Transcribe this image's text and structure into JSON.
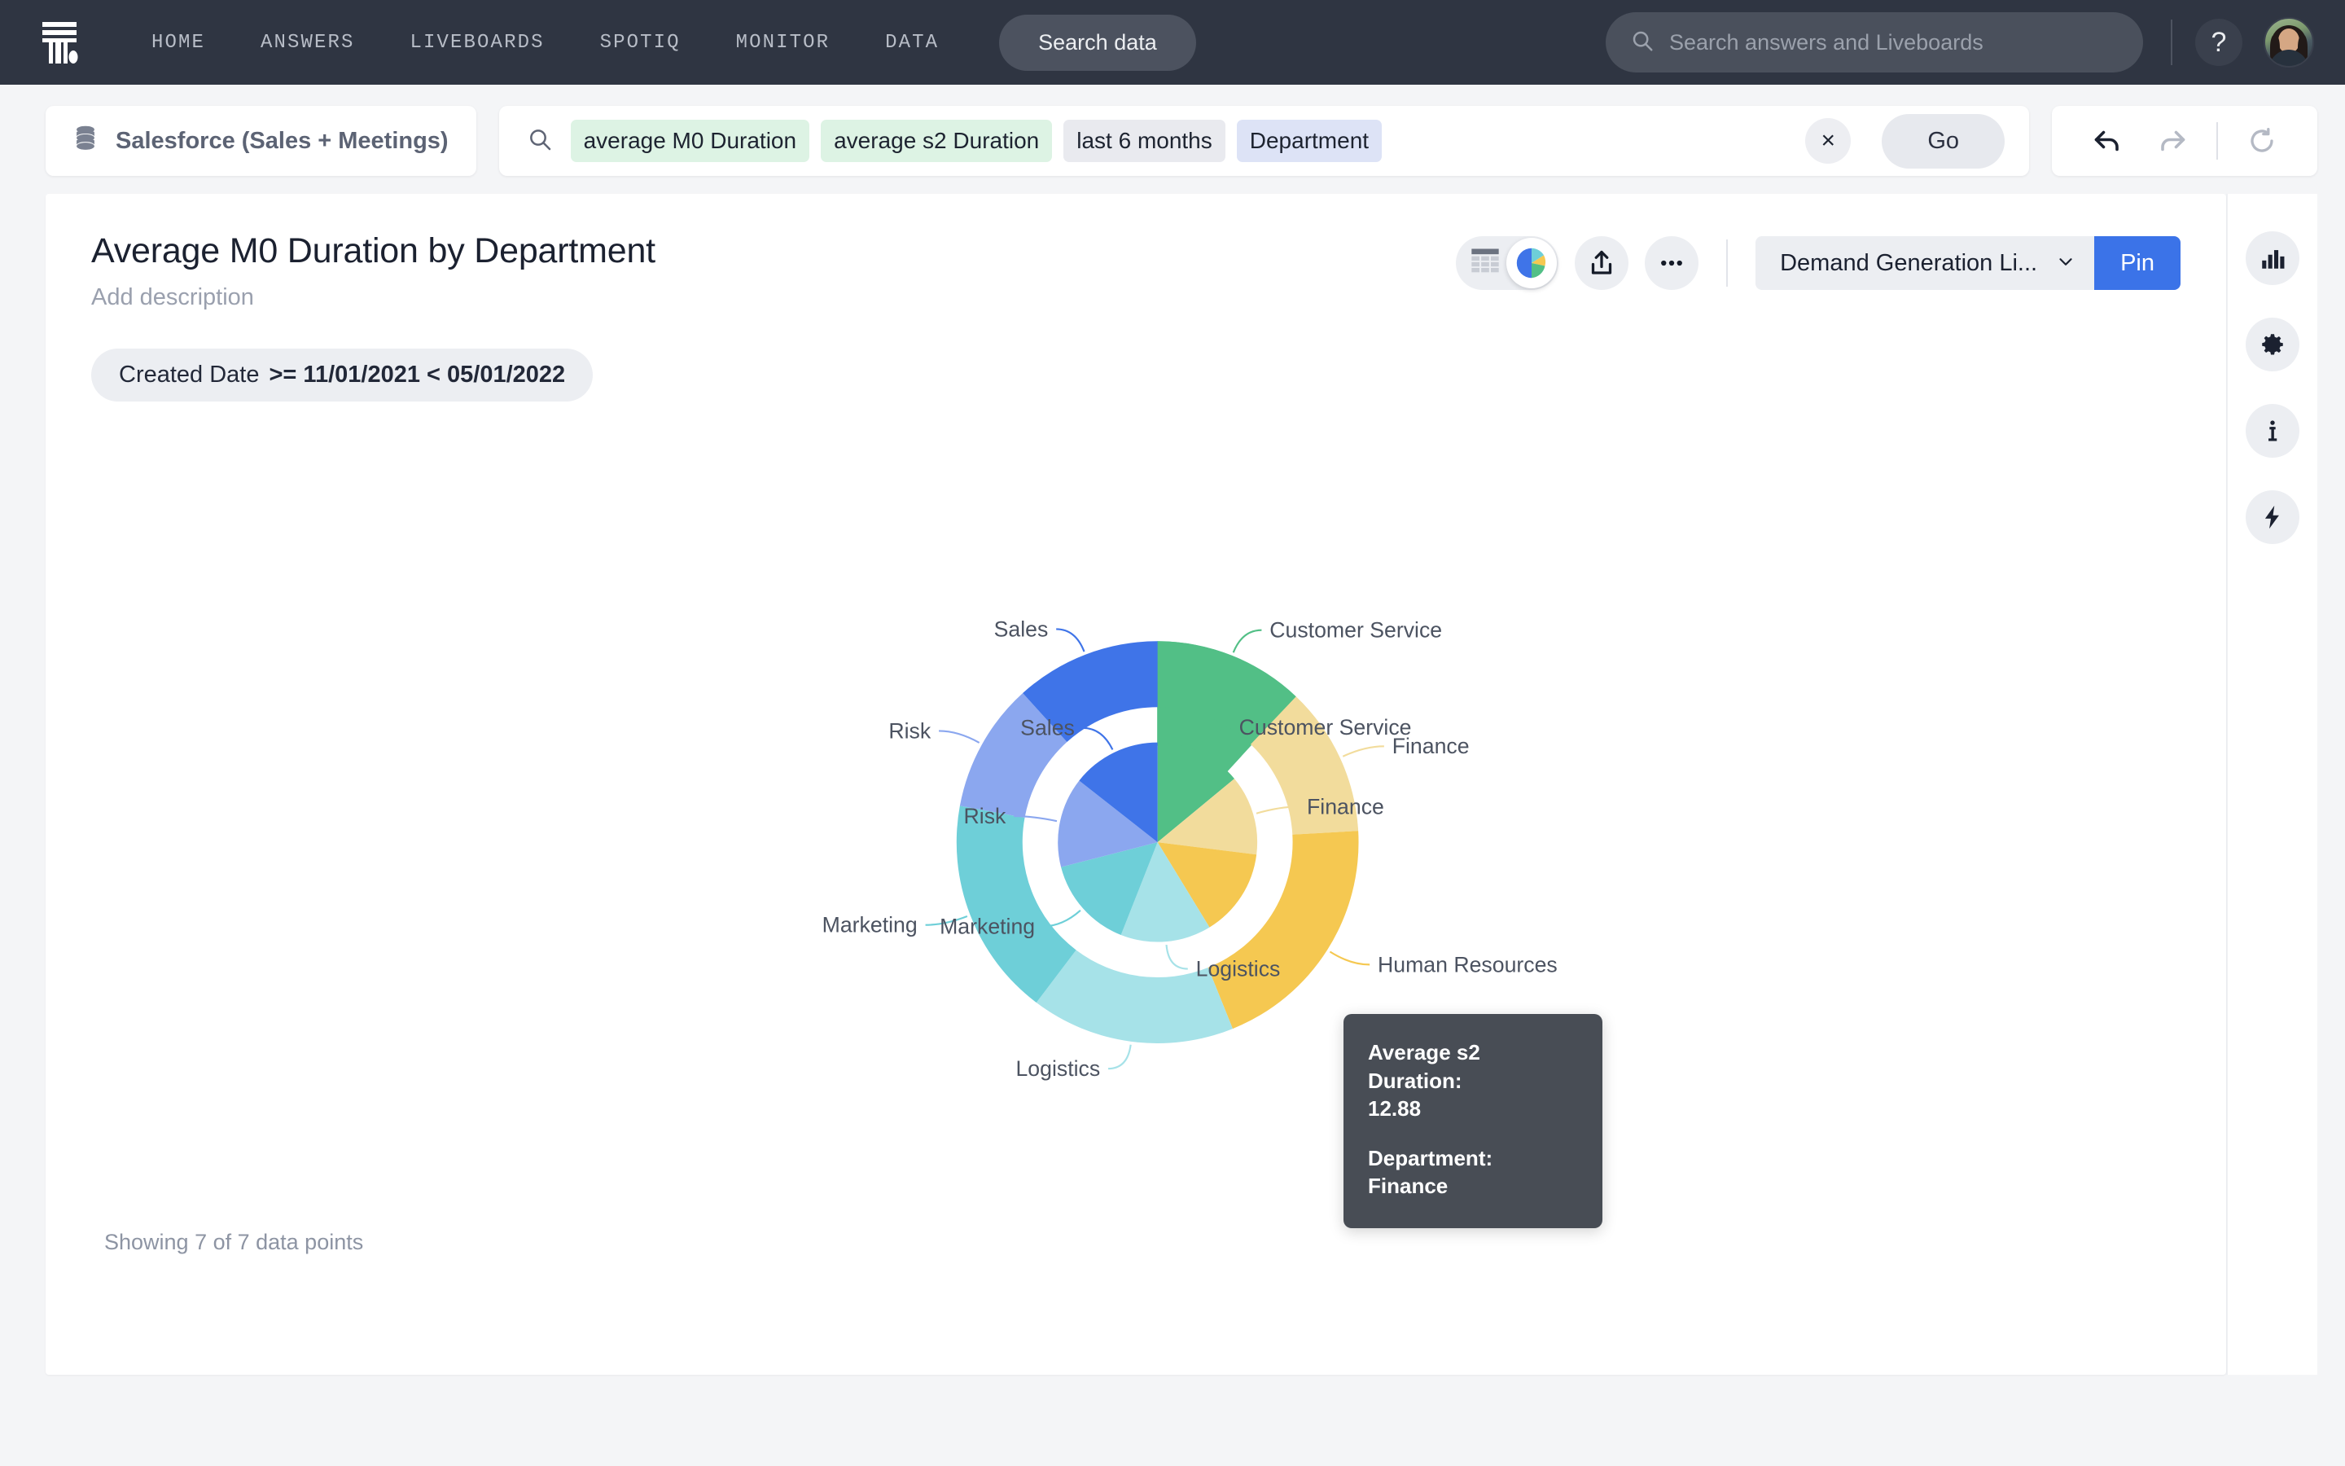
{
  "topnav": {
    "logo_name": "thoughtspot-logo",
    "links": [
      "HOME",
      "ANSWERS",
      "LIVEBOARDS",
      "SPOTIQ",
      "MONITOR",
      "DATA"
    ],
    "search_data_label": "Search data",
    "global_search_placeholder": "Search answers and Liveboards",
    "global_search_value": "",
    "help_label": "?",
    "brand_bg": "#2f3542"
  },
  "querybar": {
    "source_label": "Salesforce (Sales + Meetings)",
    "tokens": [
      {
        "text": "average M0 Duration",
        "kind": "measure"
      },
      {
        "text": "average s2 Duration",
        "kind": "measure"
      },
      {
        "text": "last 6 months",
        "kind": "time"
      },
      {
        "text": "Department",
        "kind": "attr"
      }
    ],
    "clear_label": "×",
    "go_label": "Go",
    "undo_label": "undo",
    "redo_label": "redo",
    "reset_label": "reset"
  },
  "answer": {
    "title": "Average M0 Duration by Department",
    "description": "Add description",
    "filter": {
      "field": "Created Date",
      "value": ">= 11/01/2021 < 05/01/2022"
    },
    "liveboard_select": "Demand Generation Li...",
    "pin_label": "Pin",
    "footer": "Showing 7 of 7 data points"
  },
  "tooltip": {
    "measure_label": "Average s2 Duration:",
    "measure_value": "12.88",
    "attr_label": "Department:",
    "attr_value": "Finance"
  },
  "right_rail": {
    "items": [
      {
        "name": "chart-config-icon",
        "title": "Chart configuration"
      },
      {
        "name": "gear-icon",
        "title": "Settings"
      },
      {
        "name": "info-icon",
        "title": "Info"
      },
      {
        "name": "bolt-icon",
        "title": "SpotIQ"
      }
    ]
  },
  "chart_data": {
    "type": "pie",
    "title": "Average M0 Duration by Department",
    "variant": "nested-donut",
    "legend_position": "none",
    "labels_position": "outside-with-leader-lines",
    "categories": [
      "Customer Service",
      "Finance",
      "Human Resources",
      "Logistics",
      "Marketing",
      "Risk",
      "Sales"
    ],
    "colors": [
      "#52bf86",
      "#f4dc96",
      "#f6c council",
      "#f6c košar",
      "#7fd9e0",
      "#8aa8ef",
      "#3f74e8"
    ],
    "palette": {
      "Customer Service": "#52bf86",
      "Finance": "#f2dc9c",
      "Human Resources": "#f5c council",
      "Logistics": "#a6e2e8",
      "Marketing": "#6ecfd8",
      "Risk": "#8ba7ef",
      "Sales": "#3f74e8"
    },
    "series": [
      {
        "name": "Average s2 Duration",
        "ring": "inner",
        "values": [
          13.9,
          12.88,
          14.2,
          14.6,
          14.9,
          14.5,
          14.3
        ],
        "percents": [
          13.8,
          12.8,
          14.1,
          14.5,
          14.8,
          15.0,
          15.0
        ]
      },
      {
        "name": "Average M0 Duration",
        "ring": "outer",
        "values": [
          12.1,
          12.0,
          19.8,
          16.4,
          17.6,
          10.4,
          11.7
        ],
        "percents": [
          12.1,
          12.0,
          19.8,
          16.4,
          17.6,
          10.4,
          11.7
        ]
      }
    ],
    "inner_labels": [
      "Sales",
      "Customer Service",
      "Finance",
      "Logistics",
      "Marketing",
      "Risk"
    ],
    "outer_labels": [
      "Sales",
      "Customer Service",
      "Finance",
      "Human Resources",
      "Logistics",
      "Marketing",
      "Risk"
    ],
    "xlabel": "",
    "ylabel": ""
  }
}
